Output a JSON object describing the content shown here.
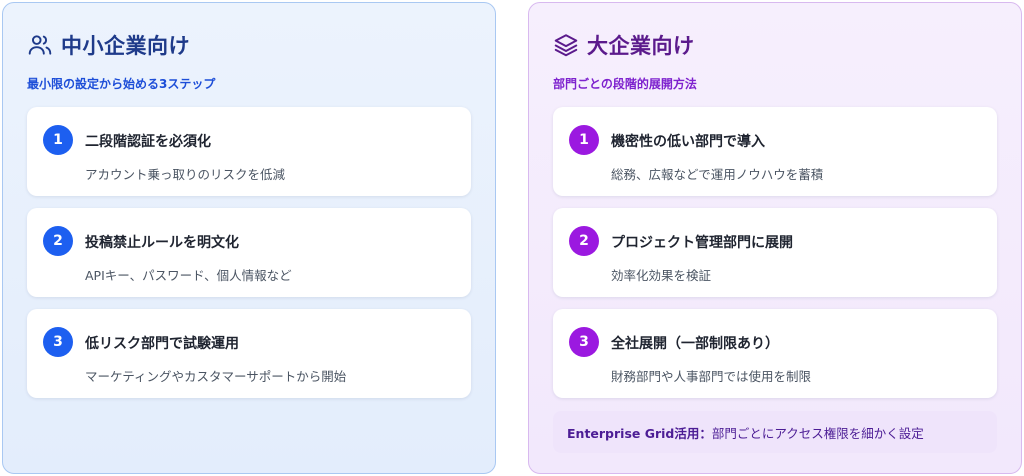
{
  "smb": {
    "title": "中小企業向け",
    "icon": "users-icon",
    "subtitle": "最小限の設定から始める3ステップ",
    "accent": "#1d5ff0",
    "steps": [
      {
        "num": "1",
        "title": "二段階認証を必須化",
        "desc": "アカウント乗っ取りのリスクを低減"
      },
      {
        "num": "2",
        "title": "投稿禁止ルールを明文化",
        "desc": "APIキー、パスワード、個人情報など"
      },
      {
        "num": "3",
        "title": "低リスク部門で試験運用",
        "desc": "マーケティングやカスタマーサポートから開始"
      }
    ]
  },
  "ent": {
    "title": "大企業向け",
    "icon": "layers-icon",
    "subtitle": "部門ごとの段階的展開方法",
    "accent": "#9b19e0",
    "steps": [
      {
        "num": "1",
        "title": "機密性の低い部門で導入",
        "desc": "総務、広報などで運用ノウハウを蓄積"
      },
      {
        "num": "2",
        "title": "プロジェクト管理部門に展開",
        "desc": "効率化効果を検証"
      },
      {
        "num": "3",
        "title": "全社展開（一部制限あり）",
        "desc": "財務部門や人事部門では使用を制限"
      }
    ],
    "note": {
      "label": "Enterprise Grid活用：",
      "text": "部門ごとにアクセス権限を細かく設定"
    }
  }
}
